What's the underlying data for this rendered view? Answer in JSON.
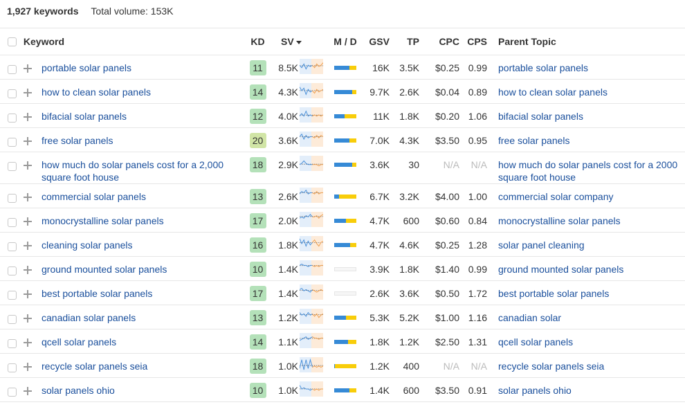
{
  "summary": {
    "count_label": "1,927 keywords",
    "total_volume_label": "Total volume: 153K"
  },
  "colors": {
    "link": "#1a4f9c",
    "mobile": "#368ad6",
    "desktop": "#f8cd0a",
    "kd_easy": "#b4e1b9",
    "kd_medium": "#d1e5a6",
    "spark_blue": "#4a90d9",
    "spark_orange": "#f0a050"
  },
  "columns": {
    "keyword": "Keyword",
    "kd": "KD",
    "sv": "SV",
    "md": "M / D",
    "gsv": "GSV",
    "tp": "TP",
    "cpc": "CPC",
    "cps": "CPS",
    "parent_topic": "Parent Topic"
  },
  "sort": {
    "column": "SV",
    "direction": "desc"
  },
  "rows": [
    {
      "keyword": "portable solar panels",
      "kd": "11",
      "sv": "8.5K",
      "mobile": 0.68,
      "gsv": "16K",
      "tp": "3.5K",
      "cpc": "$0.25",
      "cps": "0.99",
      "parent": "portable solar panels",
      "trend": [
        6,
        4,
        7,
        3,
        6,
        5,
        6,
        4,
        7,
        5,
        6,
        8
      ]
    },
    {
      "keyword": "how to clean solar panels",
      "kd": "14",
      "sv": "4.3K",
      "mobile": 0.8,
      "gsv": "9.7K",
      "tp": "2.6K",
      "cpc": "$0.04",
      "cps": "0.89",
      "parent": "how to clean solar panels",
      "trend": [
        8,
        5,
        7,
        2,
        6,
        4,
        5,
        3,
        6,
        4,
        5,
        6
      ]
    },
    {
      "keyword": "bifacial solar panels",
      "kd": "12",
      "sv": "4.0K",
      "mobile": 0.48,
      "gsv": "11K",
      "tp": "1.8K",
      "cpc": "$0.20",
      "cps": "1.06",
      "parent": "bifacial solar panels",
      "trend": [
        4,
        6,
        4,
        8,
        4,
        5,
        4,
        5,
        4,
        5,
        4,
        5
      ]
    },
    {
      "keyword": "free solar panels",
      "kd": "20",
      "sv": "3.6K",
      "mobile": 0.68,
      "gsv": "7.0K",
      "tp": "4.3K",
      "cpc": "$3.50",
      "cps": "0.95",
      "parent": "free solar panels",
      "trend": [
        7,
        9,
        5,
        8,
        6,
        7,
        7,
        6,
        8,
        6,
        8,
        7
      ]
    },
    {
      "keyword": "how much do solar panels cost for a 2,000 square foot house",
      "kd": "18",
      "sv": "2.9K",
      "mobile": 0.81,
      "gsv": "3.6K",
      "tp": "30",
      "cpc": "N/A",
      "cps": "N/A",
      "parent": "how much do solar panels cost for a 2000 square foot house",
      "trend": [
        4,
        5,
        7,
        5,
        4,
        4,
        4,
        4,
        4,
        3,
        4,
        4
      ]
    },
    {
      "keyword": "commercial solar panels",
      "kd": "13",
      "sv": "2.6K",
      "mobile": 0.22,
      "gsv": "6.7K",
      "tp": "3.2K",
      "cpc": "$4.00",
      "cps": "1.00",
      "parent": "commercial solar company",
      "trend": [
        6,
        8,
        7,
        9,
        6,
        7,
        7,
        6,
        8,
        6,
        7,
        7
      ]
    },
    {
      "keyword": "monocrystalline solar panels",
      "kd": "17",
      "sv": "2.0K",
      "mobile": 0.52,
      "gsv": "4.7K",
      "tp": "600",
      "cpc": "$0.60",
      "cps": "0.84",
      "parent": "monocrystalline solar panels",
      "trend": [
        6,
        7,
        6,
        8,
        7,
        9,
        7,
        7,
        8,
        6,
        8,
        9
      ]
    },
    {
      "keyword": "cleaning solar panels",
      "kd": "16",
      "sv": "1.8K",
      "mobile": 0.72,
      "gsv": "4.7K",
      "tp": "4.6K",
      "cpc": "$0.25",
      "cps": "1.28",
      "parent": "solar panel cleaning",
      "trend": [
        9,
        5,
        8,
        3,
        7,
        4,
        6,
        8,
        5,
        3,
        6,
        7
      ]
    },
    {
      "keyword": "ground mounted solar panels",
      "kd": "10",
      "sv": "1.4K",
      "mobile": 0,
      "gsv": "3.9K",
      "tp": "1.8K",
      "cpc": "$1.40",
      "cps": "0.99",
      "parent": "ground mounted solar panels",
      "trend": [
        7,
        8,
        7,
        7,
        6,
        7,
        7,
        6,
        7,
        6,
        7,
        7
      ]
    },
    {
      "keyword": "best portable solar panels",
      "kd": "17",
      "sv": "1.4K",
      "mobile": 0,
      "gsv": "2.6K",
      "tp": "3.6K",
      "cpc": "$0.50",
      "cps": "1.72",
      "parent": "best portable solar panels",
      "trend": [
        7,
        8,
        6,
        7,
        6,
        5,
        7,
        6,
        5,
        6,
        7,
        6
      ]
    },
    {
      "keyword": "canadian solar panels",
      "kd": "13",
      "sv": "1.2K",
      "mobile": 0.52,
      "gsv": "5.3K",
      "tp": "5.2K",
      "cpc": "$1.00",
      "cps": "1.16",
      "parent": "canadian solar",
      "trend": [
        8,
        6,
        7,
        5,
        8,
        6,
        7,
        5,
        7,
        4,
        6,
        7
      ]
    },
    {
      "keyword": "qcell solar panels",
      "kd": "14",
      "sv": "1.1K",
      "mobile": 0.62,
      "gsv": "1.8K",
      "tp": "1.2K",
      "cpc": "$2.50",
      "cps": "1.31",
      "parent": "qcell solar panels",
      "trend": [
        5,
        6,
        7,
        8,
        6,
        7,
        8,
        7,
        7,
        6,
        7,
        7
      ]
    },
    {
      "keyword": "recycle solar panels seia",
      "kd": "18",
      "sv": "1.0K",
      "mobile": 0.03,
      "gsv": "1.2K",
      "tp": "400",
      "cpc": "N/A",
      "cps": "N/A",
      "parent": "recycle solar panels seia",
      "trend": [
        2,
        9,
        1,
        9,
        2,
        9,
        3,
        4,
        3,
        4,
        3,
        4
      ]
    },
    {
      "keyword": "solar panels ohio",
      "kd": "10",
      "sv": "1.0K",
      "mobile": 0.68,
      "gsv": "1.4K",
      "tp": "600",
      "cpc": "$3.50",
      "cps": "0.91",
      "parent": "solar panels ohio",
      "trend": [
        8,
        5,
        6,
        5,
        5,
        4,
        5,
        4,
        5,
        4,
        5,
        5
      ]
    }
  ]
}
